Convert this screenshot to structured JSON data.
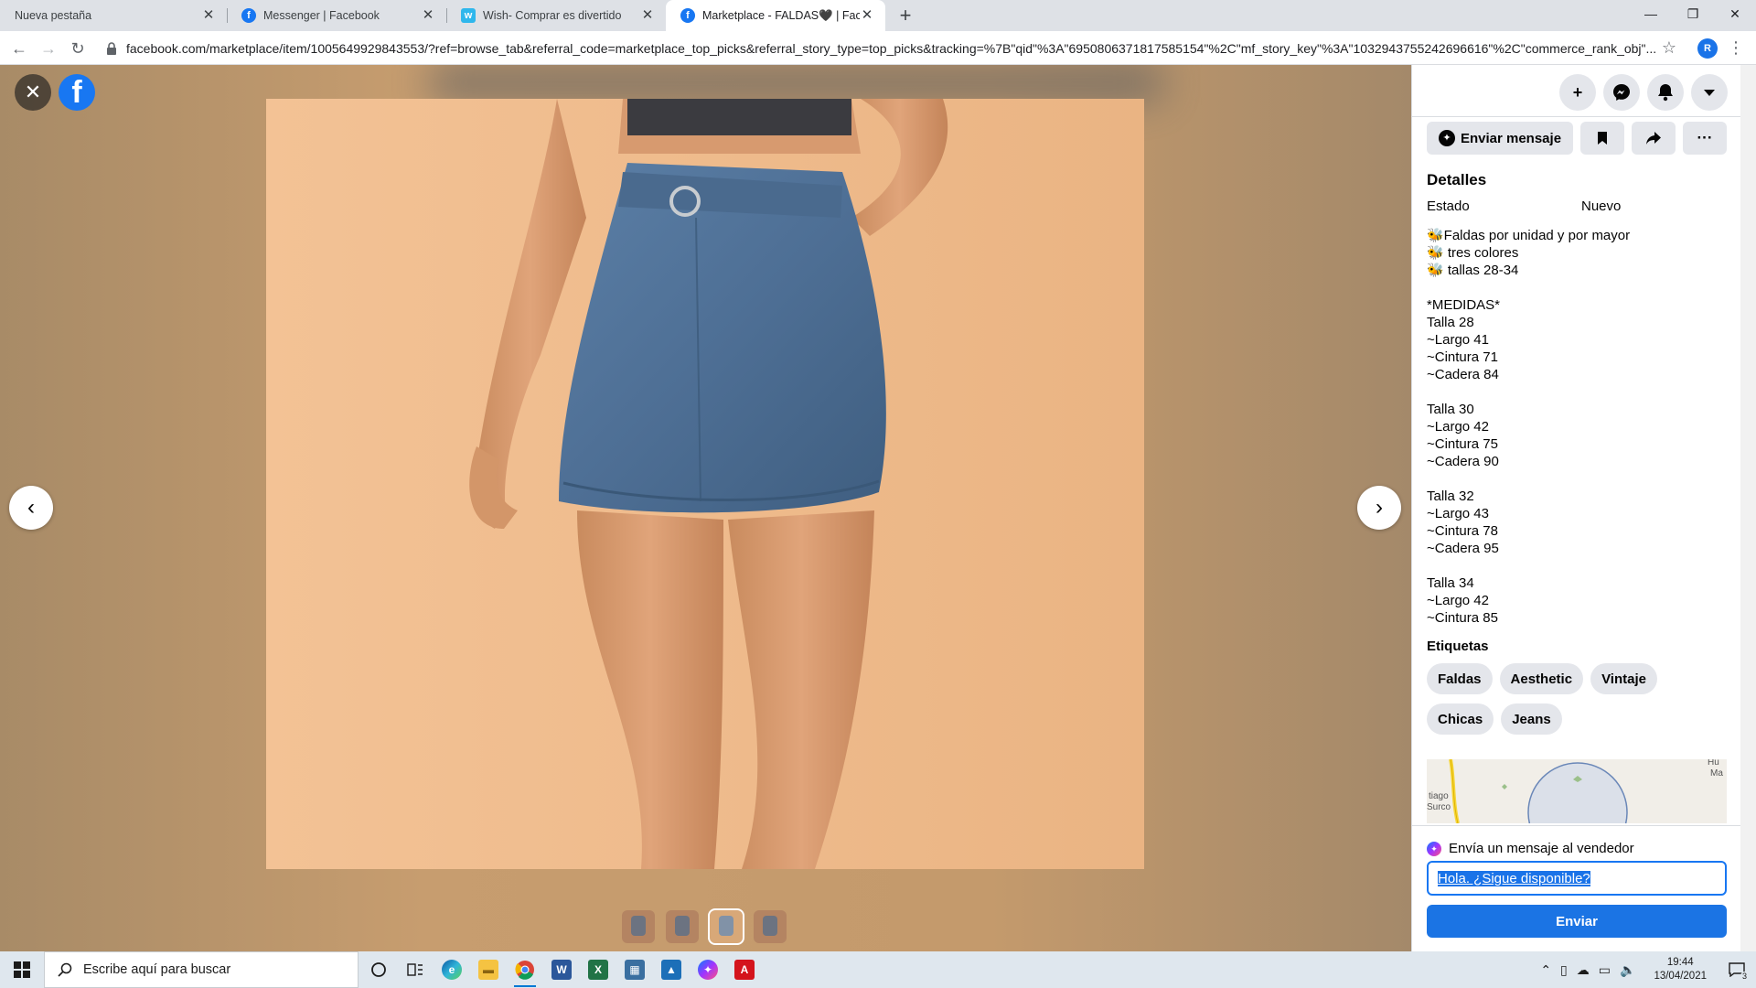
{
  "browser": {
    "tabs": [
      {
        "title": "Nueva pestaña",
        "favicon": "none",
        "active": false
      },
      {
        "title": "Messenger | Facebook",
        "favicon": "facebook-icon",
        "active": false
      },
      {
        "title": "Wish- Comprar es divertido",
        "favicon": "wish-icon",
        "active": false
      },
      {
        "title": "Marketplace - FALDAS🖤 | Faceb",
        "favicon": "facebook-icon",
        "active": true
      }
    ],
    "url": "facebook.com/marketplace/item/1005649929843553/?ref=browse_tab&referral_code=marketplace_top_picks&referral_story_type=top_picks&tracking=%7B\"qid\"%3A\"6950806371817585154\"%2C\"mf_story_key\"%3A\"1032943755242696616\"%2C\"commerce_rank_obj\"...",
    "profile_initial": "R"
  },
  "panel": {
    "send_message_label": "Enviar mensaje",
    "details_title": "Detalles",
    "condition_label": "Estado",
    "condition_value": "Nuevo",
    "description": [
      "🐝Faldas por unidad y por mayor",
      "🐝 tres colores",
      "🐝 tallas 28-34",
      "",
      "*MEDIDAS*",
      "Talla 28",
      "~Largo 41",
      "~Cintura 71",
      "~Cadera 84",
      "",
      "Talla 30",
      "~Largo 42",
      "~Cintura 75",
      "~Cadera 90",
      "",
      "Talla 32",
      "~Largo 43",
      "~Cintura 78",
      "~Cadera 95",
      "",
      "Talla 34",
      "~Largo 42",
      "~Cintura 85"
    ],
    "tags_title": "Etiquetas",
    "tags": [
      "Faldas",
      "Aesthetic",
      "Vintaje",
      "Chicas",
      "Jeans"
    ],
    "map_labels": [
      "tiago",
      "Surco",
      "Hu",
      "Ma"
    ]
  },
  "compose": {
    "label": "Envía un mensaje al vendedor",
    "value": "Hola. ¿Sigue disponible?",
    "send_label": "Enviar"
  },
  "viewer": {
    "thumbnail_count": 4,
    "selected_thumbnail": 3
  },
  "taskbar": {
    "search_placeholder": "Escribe aquí para buscar",
    "time": "19:44",
    "date": "13/04/2021",
    "notification_count": "3"
  },
  "colors": {
    "facebook_blue": "#1877f2",
    "send_button": "#1b74e4",
    "chip_grey": "#e4e6eb"
  }
}
